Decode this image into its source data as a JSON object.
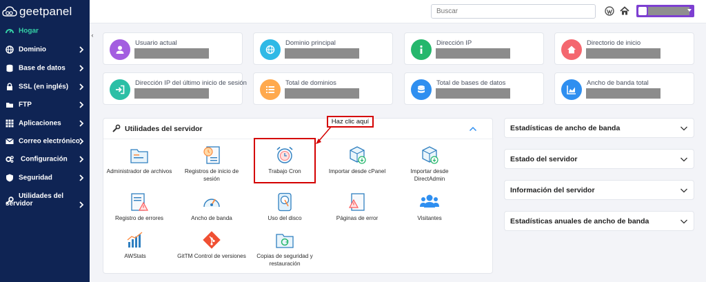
{
  "brand": {
    "logo_text": "geetpanel"
  },
  "sidebar": {
    "items": [
      {
        "label": "Hogar",
        "icon": "dashboard-icon",
        "active": true
      },
      {
        "label": "Dominio",
        "icon": "globe-icon"
      },
      {
        "label": "Base de datos",
        "icon": "database-icon"
      },
      {
        "label": "SSL (en inglés)",
        "icon": "lock-icon"
      },
      {
        "label": "FTP",
        "icon": "folder-icon"
      },
      {
        "label": "Aplicaciones",
        "icon": "grid-icon"
      },
      {
        "label": "Correo electrónico",
        "icon": "envelope-icon"
      },
      {
        "label": "Configuración",
        "icon": "gears-icon"
      },
      {
        "label": "Seguridad",
        "icon": "shield-icon"
      },
      {
        "label": "Utilidades del servidor",
        "icon": "wrench-icon"
      }
    ],
    "collapse_glyph": "‹"
  },
  "topbar": {
    "search_placeholder": "Buscar",
    "icons": [
      "wordpress-icon",
      "home-icon"
    ],
    "user_button_color": "#7d3fd1"
  },
  "cards": [
    {
      "label": "Usuario actual",
      "color": "#a35ee0",
      "icon": "user-icon"
    },
    {
      "label": "Dominio principal",
      "color": "#2fb9e6",
      "icon": "globe-icon"
    },
    {
      "label": "Dirección IP",
      "color": "#25b76c",
      "icon": "info-icon"
    },
    {
      "label": "Directorio de inicio",
      "color": "#f4676f",
      "icon": "home-icon"
    },
    {
      "label": "Dirección IP del último inicio de sesión",
      "color": "#2bbfa6",
      "icon": "sign-in-icon"
    },
    {
      "label": "Total de dominios",
      "color": "#ffa94d",
      "icon": "list-icon"
    },
    {
      "label": "Total de bases de datos",
      "color": "#2f8ff0",
      "icon": "database-icon"
    },
    {
      "label": "Ancho de banda total",
      "color": "#2f8ff0",
      "icon": "chart-area-icon"
    }
  ],
  "utilities": {
    "title": "Utilidades del servidor",
    "items": [
      {
        "label": "Administrador de archivos",
        "icon": "file-manager-icon"
      },
      {
        "label": "Registros de inicio de sesión",
        "icon": "login-log-icon"
      },
      {
        "label": "Trabajo Cron",
        "icon": "alarm-clock-icon"
      },
      {
        "label": "Importar desde cPanel",
        "icon": "import-box-icon"
      },
      {
        "label": "Importar desde DirectAdmin",
        "icon": "import-box-icon"
      },
      {
        "label": "Registro de errores",
        "icon": "error-log-icon"
      },
      {
        "label": "Ancho de banda",
        "icon": "speedometer-icon"
      },
      {
        "label": "Uso del disco",
        "icon": "disk-usage-icon"
      },
      {
        "label": "Páginas de error",
        "icon": "error-page-icon"
      },
      {
        "label": "Visitantes",
        "icon": "users-icon"
      },
      {
        "label": "AWStats",
        "icon": "awstats-icon"
      },
      {
        "label": "GitTM Control de versiones",
        "icon": "git-icon"
      },
      {
        "label": "Copias de seguridad y restauración",
        "icon": "backup-folder-icon"
      }
    ]
  },
  "annotation": {
    "callout": "Haz clic aquí",
    "color": "#d40000"
  },
  "side_panels": [
    {
      "title": "Estadísticas de ancho de banda"
    },
    {
      "title": "Estado del servidor"
    },
    {
      "title": "Información del servidor"
    },
    {
      "title": "Estadísticas anuales de ancho de banda"
    }
  ]
}
